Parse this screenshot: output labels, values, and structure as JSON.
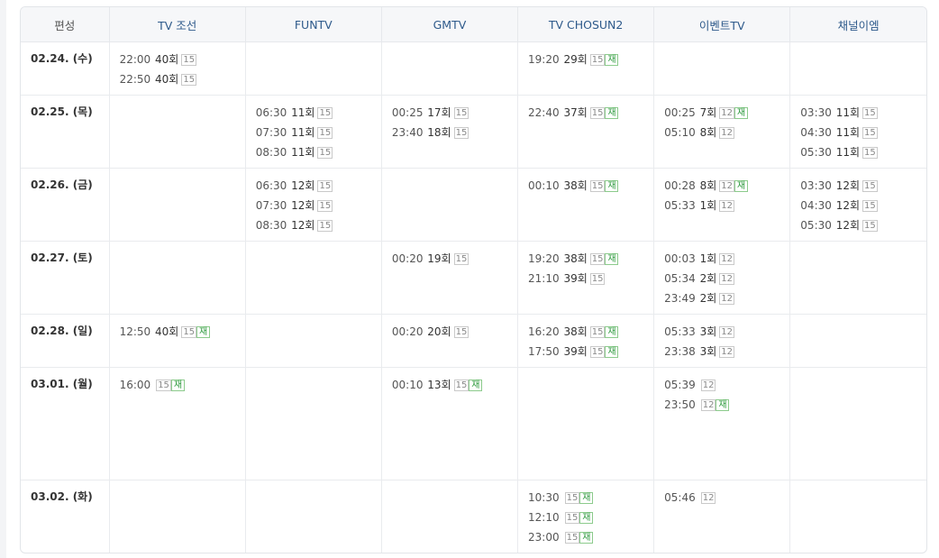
{
  "headers": [
    "편성",
    "TV 조선",
    "FUNTV",
    "GMTV",
    "TV CHOSUN2",
    "이벤트TV",
    "채널이엠"
  ],
  "rows": [
    {
      "date": "02.24. (수)",
      "cells": [
        [
          {
            "time": "22:00",
            "ep": "40회",
            "rating": "15"
          },
          {
            "time": "22:50",
            "ep": "40회",
            "rating": "15"
          }
        ],
        [],
        [],
        [
          {
            "time": "19:20",
            "ep": "29회",
            "rating": "15",
            "rerun": "재"
          }
        ],
        [],
        []
      ]
    },
    {
      "date": "02.25. (목)",
      "cells": [
        [],
        [
          {
            "time": "06:30",
            "ep": "11회",
            "rating": "15"
          },
          {
            "time": "07:30",
            "ep": "11회",
            "rating": "15"
          },
          {
            "time": "08:30",
            "ep": "11회",
            "rating": "15"
          }
        ],
        [
          {
            "time": "00:25",
            "ep": "17회",
            "rating": "15"
          },
          {
            "time": "23:40",
            "ep": "18회",
            "rating": "15"
          }
        ],
        [
          {
            "time": "22:40",
            "ep": "37회",
            "rating": "15",
            "rerun": "재"
          }
        ],
        [
          {
            "time": "00:25",
            "ep": "7회",
            "rating": "12",
            "rerun": "재"
          },
          {
            "time": "05:10",
            "ep": "8회",
            "rating": "12"
          }
        ],
        [
          {
            "time": "03:30",
            "ep": "11회",
            "rating": "15"
          },
          {
            "time": "04:30",
            "ep": "11회",
            "rating": "15"
          },
          {
            "time": "05:30",
            "ep": "11회",
            "rating": "15"
          }
        ]
      ]
    },
    {
      "date": "02.26. (금)",
      "cells": [
        [],
        [
          {
            "time": "06:30",
            "ep": "12회",
            "rating": "15"
          },
          {
            "time": "07:30",
            "ep": "12회",
            "rating": "15"
          },
          {
            "time": "08:30",
            "ep": "12회",
            "rating": "15"
          }
        ],
        [],
        [
          {
            "time": "00:10",
            "ep": "38회",
            "rating": "15",
            "rerun": "재"
          }
        ],
        [
          {
            "time": "00:28",
            "ep": "8회",
            "rating": "12",
            "rerun": "재"
          },
          {
            "time": "05:33",
            "ep": "1회",
            "rating": "12"
          }
        ],
        [
          {
            "time": "03:30",
            "ep": "12회",
            "rating": "15"
          },
          {
            "time": "04:30",
            "ep": "12회",
            "rating": "15"
          },
          {
            "time": "05:30",
            "ep": "12회",
            "rating": "15"
          }
        ]
      ]
    },
    {
      "date": "02.27. (토)",
      "cells": [
        [],
        [],
        [
          {
            "time": "00:20",
            "ep": "19회",
            "rating": "15"
          }
        ],
        [
          {
            "time": "19:20",
            "ep": "38회",
            "rating": "15",
            "rerun": "재"
          },
          {
            "time": "21:10",
            "ep": "39회",
            "rating": "15"
          }
        ],
        [
          {
            "time": "00:03",
            "ep": "1회",
            "rating": "12"
          },
          {
            "time": "05:34",
            "ep": "2회",
            "rating": "12"
          },
          {
            "time": "23:49",
            "ep": "2회",
            "rating": "12"
          }
        ],
        []
      ]
    },
    {
      "date": "02.28. (일)",
      "cells": [
        [
          {
            "time": "12:50",
            "ep": "40회",
            "rating": "15",
            "rerun": "재"
          }
        ],
        [],
        [
          {
            "time": "00:20",
            "ep": "20회",
            "rating": "15"
          }
        ],
        [
          {
            "time": "16:20",
            "ep": "38회",
            "rating": "15",
            "rerun": "재"
          },
          {
            "time": "17:50",
            "ep": "39회",
            "rating": "15",
            "rerun": "재"
          }
        ],
        [
          {
            "time": "05:33",
            "ep": "3회",
            "rating": "12"
          },
          {
            "time": "23:38",
            "ep": "3회",
            "rating": "12"
          }
        ],
        []
      ]
    },
    {
      "date": "03.01. (월)",
      "cells": [
        [
          {
            "time": "16:00",
            "ep": "",
            "rating": "15",
            "rerun": "재"
          }
        ],
        [],
        [
          {
            "time": "00:10",
            "ep": "13회",
            "rating": "15",
            "rerun": "재"
          }
        ],
        [],
        [
          {
            "time": "05:39",
            "ep": "",
            "rating": "12"
          },
          {
            "time": "23:50",
            "ep": "",
            "rating": "12",
            "rerun": "재"
          }
        ],
        []
      ]
    },
    {
      "date": "03.02. (화)",
      "cells": [
        [],
        [],
        [],
        [
          {
            "time": "10:30",
            "ep": "",
            "rating": "15",
            "rerun": "재"
          },
          {
            "time": "12:10",
            "ep": "",
            "rating": "15",
            "rerun": "재"
          },
          {
            "time": "23:00",
            "ep": "",
            "rating": "15",
            "rerun": "재"
          }
        ],
        [
          {
            "time": "05:46",
            "ep": "",
            "rating": "12"
          }
        ],
        []
      ]
    }
  ]
}
